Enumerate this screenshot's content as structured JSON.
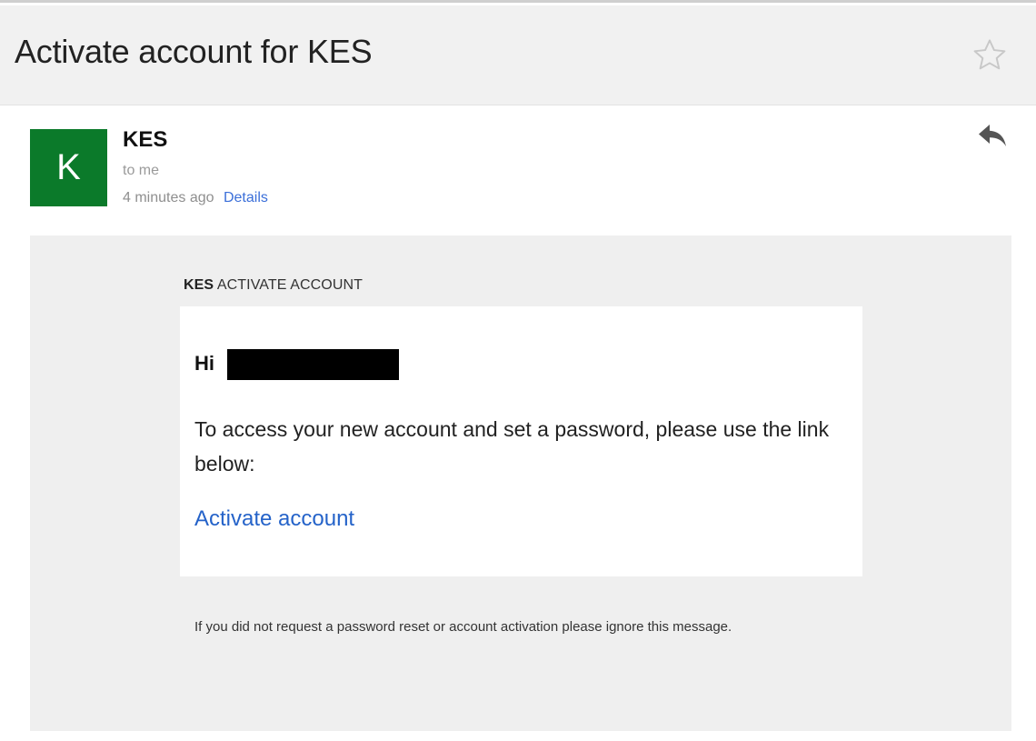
{
  "subject": {
    "title": "Activate account for KES"
  },
  "sender": {
    "avatar_letter": "K",
    "avatar_color": "#0b7a2a",
    "name": "KES",
    "recipient": "to me",
    "timestamp": "4 minutes ago",
    "details_label": "Details"
  },
  "icons": {
    "star": "star-outline-icon",
    "reply": "reply-icon"
  },
  "email": {
    "header_brand": "KES",
    "header_label": "ACTIVATE ACCOUNT",
    "greeting": "Hi",
    "body_text": "To access your new account and set a password, please use the link below:",
    "link_label": "Activate account",
    "footer_note": "If you did not request a password reset or account activation please ignore this message."
  }
}
